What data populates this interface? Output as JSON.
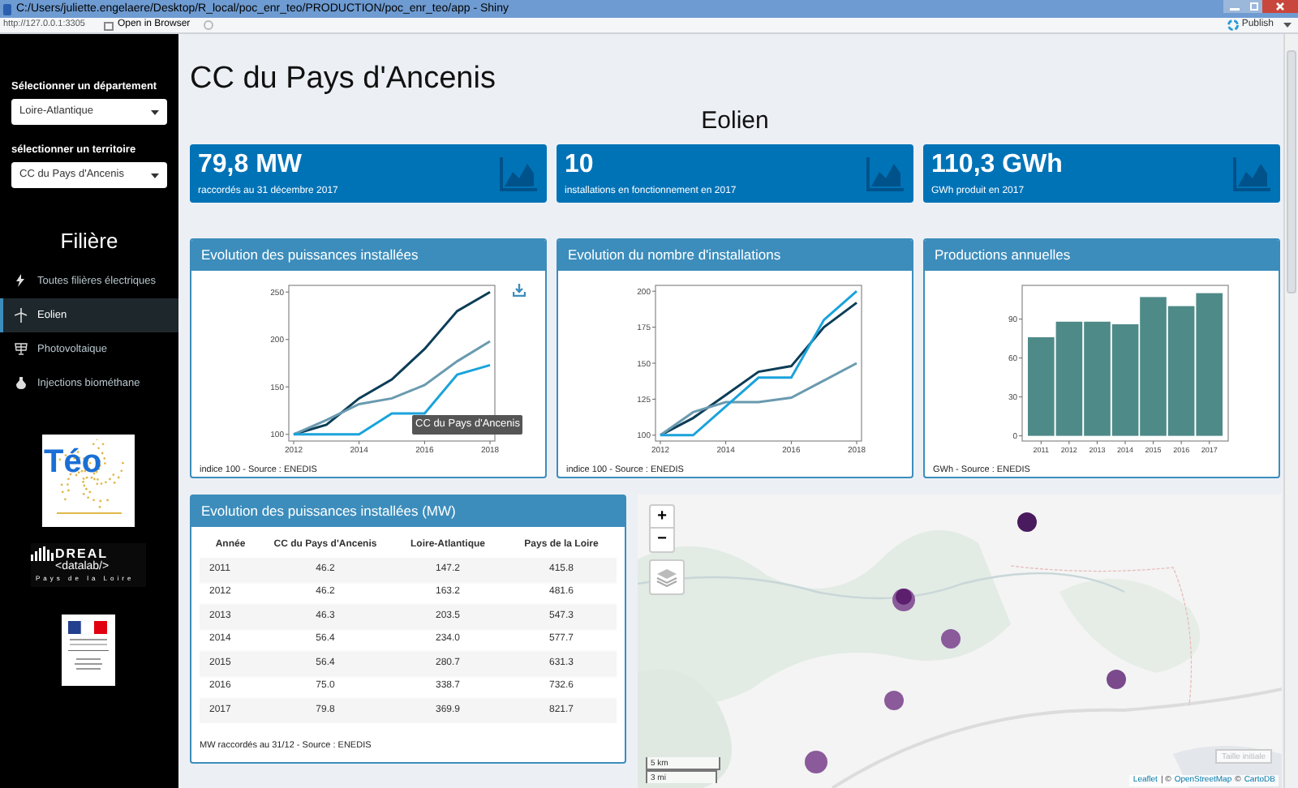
{
  "window": {
    "title": "C:/Users/juliette.engelaere/Desktop/R_local/poc_enr_teo/PRODUCTION/poc_enr_teo/app - Shiny"
  },
  "toolbar": {
    "url": "http://127.0.0.1:3305",
    "open_button": "Open in Browser",
    "publish_button": "Publish"
  },
  "sidebar": {
    "selects": [
      {
        "label": "Sélectionner un département",
        "value": "Loire-Atlantique"
      },
      {
        "label": "sélectionner un territoire",
        "value": "CC du Pays d'Ancenis"
      }
    ],
    "section_title": "Filière",
    "items": [
      {
        "label": "Toutes filières électriques",
        "kind": "lightning",
        "selected": false
      },
      {
        "label": "Eolien",
        "kind": "turbine",
        "selected": true
      },
      {
        "label": "Photovoltaique",
        "kind": "solar",
        "selected": false
      },
      {
        "label": "Injections biométhane",
        "kind": "drop",
        "selected": false
      }
    ],
    "logos": {
      "teo": "Téo",
      "dreal": "DREAL",
      "datalab": "<datalab/>",
      "region": "Pays de la Loire"
    }
  },
  "page": {
    "title": "CC du Pays d'Ancenis",
    "subtitle": "Eolien"
  },
  "value_boxes": [
    {
      "value": "79,8 MW",
      "caption": "raccordés au 31 décembre 2017"
    },
    {
      "value": "10",
      "caption": "installations en fonctionnement en 2017"
    },
    {
      "value": "110,3 GWh",
      "caption": "GWh produit en 2017"
    }
  ],
  "chart_cards": [
    {
      "title": "Evolution des puissances installées",
      "caption": "indice 100 - Source : ENEDIS",
      "download_button": true,
      "tooltip": "CC du Pays d'Ancenis",
      "chart_data": {
        "type": "line",
        "x": [
          2012,
          2013,
          2014,
          2015,
          2016,
          2017,
          2018
        ],
        "xticks": [
          2012,
          2014,
          2016,
          2018
        ],
        "ylim": [
          93,
          257
        ],
        "yticks": [
          100,
          150,
          200,
          250
        ],
        "xlim": [
          2011.85,
          2018.15
        ],
        "series": [
          {
            "color": "#0c3d57",
            "values": [
              100,
              110,
              138,
              158,
              190,
              230,
              250
            ]
          },
          {
            "color": "#6a9ab0",
            "values": [
              100,
              115,
              132,
              138,
              152,
              177,
              198
            ]
          },
          {
            "color": "#1aa3dc",
            "values": [
              100,
              100,
              100,
              122,
              122,
              163,
              173
            ]
          }
        ]
      }
    },
    {
      "title": "Evolution du nombre d'installations",
      "caption": "indice 100 - Source : ENEDIS",
      "download_button": false,
      "chart_data": {
        "type": "line",
        "x": [
          2012,
          2013,
          2014,
          2015,
          2016,
          2017,
          2018
        ],
        "xticks": [
          2012,
          2014,
          2016,
          2018
        ],
        "ylim": [
          96,
          204
        ],
        "yticks": [
          100,
          125,
          150,
          175,
          200
        ],
        "xlim": [
          2011.85,
          2018.15
        ],
        "series": [
          {
            "color": "#0c3d57",
            "values": [
              100,
              112,
              128,
              144,
              148,
              175,
              192
            ]
          },
          {
            "color": "#6a9ab0",
            "values": [
              100,
              116,
              123,
              123,
              126,
              138,
              150
            ]
          },
          {
            "color": "#1aa3dc",
            "values": [
              100,
              100,
              120,
              140,
              140,
              180,
              200
            ]
          }
        ]
      }
    },
    {
      "title": "Productions annuelles",
      "caption": "GWh - Source : ENEDIS",
      "download_button": false,
      "chart_data": {
        "type": "bar",
        "categories": [
          "2011",
          "2012",
          "2013",
          "2014",
          "2015",
          "2016",
          "2017"
        ],
        "ylim": [
          -4,
          116
        ],
        "yticks": [
          0,
          30,
          60,
          90
        ],
        "series": [
          {
            "color": "#4e8a88",
            "values": [
              76,
              88,
              88,
              86,
              107,
              100,
              110
            ]
          }
        ]
      }
    }
  ],
  "table_card": {
    "title": "Evolution des puissances installées (MW)",
    "columns": [
      "Année",
      "CC du Pays d'Ancenis",
      "Loire-Atlantique",
      "Pays de la Loire"
    ],
    "rows": [
      [
        "2011",
        "46.2",
        "147.2",
        "415.8"
      ],
      [
        "2012",
        "46.2",
        "163.2",
        "481.6"
      ],
      [
        "2013",
        "46.3",
        "203.5",
        "547.3"
      ],
      [
        "2014",
        "56.4",
        "234.0",
        "577.7"
      ],
      [
        "2015",
        "56.4",
        "280.7",
        "631.3"
      ],
      [
        "2016",
        "75.0",
        "338.7",
        "732.6"
      ],
      [
        "2017",
        "79.8",
        "369.9",
        "821.7"
      ]
    ],
    "footnote": "MW raccordés au 31/12 - Source : ENEDIS"
  },
  "map": {
    "zoom_in": "+",
    "zoom_out": "−",
    "scale_km": "5 km",
    "scale_mi": "3 mi",
    "reset_button": "Taille initiale",
    "attribution": [
      {
        "text": "Leaflet",
        "link": true
      },
      {
        "text": "| ©",
        "link": false
      },
      {
        "text": "OpenStreetMap",
        "link": true
      },
      {
        "text": "©",
        "link": false
      },
      {
        "text": "CartoDB",
        "link": true
      }
    ]
  }
}
